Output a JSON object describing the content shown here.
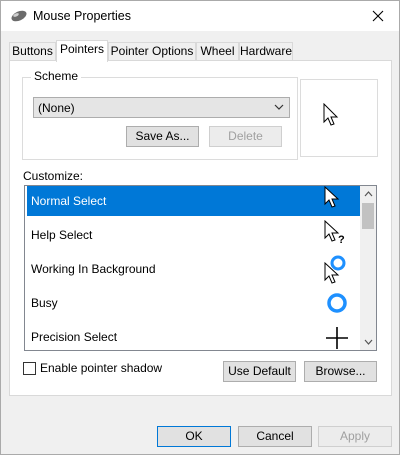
{
  "window": {
    "title": "Mouse Properties",
    "icon": "mouse-icon"
  },
  "tabs": [
    {
      "label": "Buttons",
      "active": false
    },
    {
      "label": "Pointers",
      "active": true
    },
    {
      "label": "Pointer Options",
      "active": false
    },
    {
      "label": "Wheel",
      "active": false
    },
    {
      "label": "Hardware",
      "active": false
    }
  ],
  "scheme": {
    "group_label": "Scheme",
    "selected": "(None)",
    "save_as_label": "Save As...",
    "delete_label": "Delete"
  },
  "customize": {
    "label": "Customize:",
    "items": [
      {
        "label": "Normal Select",
        "icon": "arrow-cursor-icon",
        "selected": true
      },
      {
        "label": "Help Select",
        "icon": "help-cursor-icon",
        "selected": false
      },
      {
        "label": "Working In Background",
        "icon": "working-cursor-icon",
        "selected": false
      },
      {
        "label": "Busy",
        "icon": "busy-cursor-icon",
        "selected": false
      },
      {
        "label": "Precision Select",
        "icon": "crosshair-cursor-icon",
        "selected": false
      }
    ]
  },
  "options": {
    "pointer_shadow_label": "Enable pointer shadow",
    "pointer_shadow_checked": false,
    "use_default_label": "Use Default",
    "browse_label": "Browse..."
  },
  "footer": {
    "ok_label": "OK",
    "cancel_label": "Cancel",
    "apply_label": "Apply"
  },
  "colors": {
    "selection": "#0078d7",
    "busy_ring": "#1e90ff"
  }
}
